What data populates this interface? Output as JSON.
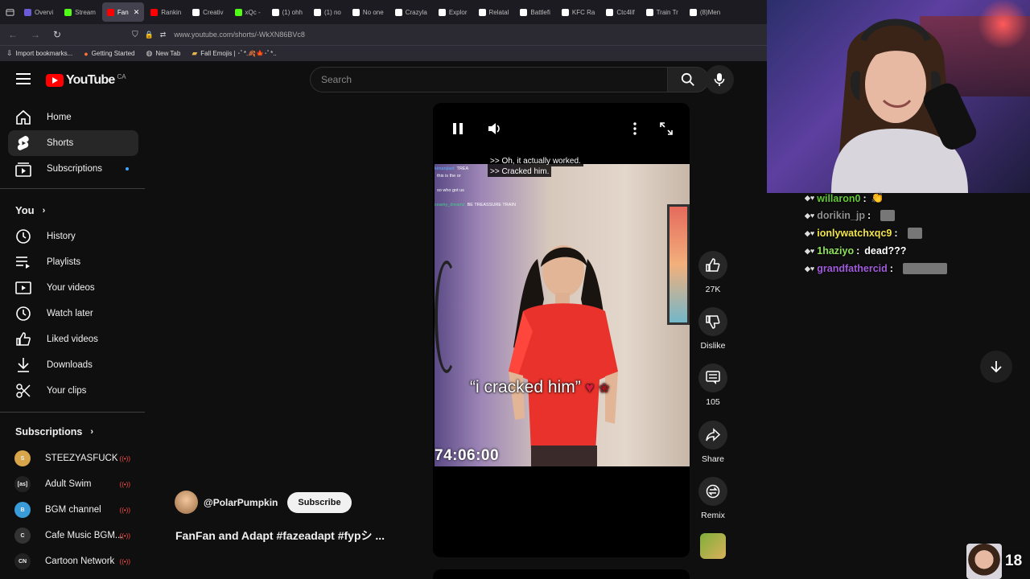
{
  "browser": {
    "tabs": [
      {
        "label": "Overvi",
        "color": "#6b5bd6"
      },
      {
        "label": "Stream",
        "color": "#53fc18"
      },
      {
        "label": "Fan",
        "color": "#ff0000",
        "active": true
      },
      {
        "label": "Rankin",
        "color": "#ff0000"
      },
      {
        "label": "Creativ",
        "color": "#ffffff"
      },
      {
        "label": "xQc -",
        "color": "#53fc18"
      },
      {
        "label": "(1) ohh",
        "color": "#ffffff"
      },
      {
        "label": "(1) no",
        "color": "#ffffff"
      },
      {
        "label": "No one",
        "color": "#ffffff"
      },
      {
        "label": "Crazyla",
        "color": "#ffffff"
      },
      {
        "label": "Explor",
        "color": "#ffffff"
      },
      {
        "label": "Relatal",
        "color": "#ffffff"
      },
      {
        "label": "Battlefi",
        "color": "#ffffff"
      },
      {
        "label": "KFC Ra",
        "color": "#ffffff"
      },
      {
        "label": "Ctc4lif",
        "color": "#ffffff"
      },
      {
        "label": "Train Tr",
        "color": "#ffffff"
      },
      {
        "label": "(8)Men",
        "color": "#ffffff"
      }
    ],
    "url": "www.youtube.com/shorts/-WkXN86BVc8",
    "bookmarks": [
      "Import bookmarks...",
      "Getting Started",
      "New Tab",
      "Fall Emojis | ･ﾟ*.🍂🍁･ﾟ*.."
    ]
  },
  "header": {
    "logo_text": "YouTube",
    "country": "CA",
    "search_placeholder": "Search"
  },
  "sidebar": {
    "main": [
      {
        "label": "Home",
        "icon": "home-icon"
      },
      {
        "label": "Shorts",
        "icon": "shorts-icon",
        "active": true
      },
      {
        "label": "Subscriptions",
        "icon": "subscriptions-icon"
      }
    ],
    "you_heading": "You",
    "you_items": [
      {
        "label": "History",
        "icon": "history-icon"
      },
      {
        "label": "Playlists",
        "icon": "playlists-icon"
      },
      {
        "label": "Your videos",
        "icon": "your-videos-icon"
      },
      {
        "label": "Watch later",
        "icon": "watch-later-icon"
      },
      {
        "label": "Liked videos",
        "icon": "liked-videos-icon"
      },
      {
        "label": "Downloads",
        "icon": "downloads-icon"
      },
      {
        "label": "Your clips",
        "icon": "clips-icon"
      }
    ],
    "subs_heading": "Subscriptions",
    "subs": [
      {
        "label": "STEEZYASFUCK",
        "avatar_color": "#d9a54a",
        "mark": "S"
      },
      {
        "label": "Adult Swim",
        "avatar_color": "#222222",
        "mark": "[as]"
      },
      {
        "label": "BGM channel",
        "avatar_color": "#3a9bd9",
        "mark": "B"
      },
      {
        "label": "Cafe Music BGM...",
        "avatar_color": "#333333",
        "mark": "C"
      },
      {
        "label": "Cartoon Network",
        "avatar_color": "#222222",
        "mark": "CN"
      }
    ]
  },
  "video": {
    "captions": [
      ">> Oh, it actually worked.",
      ">> Cracked him."
    ],
    "overlay_text": "“i cracked him”",
    "timer": "74:06:00",
    "mini_chat": [
      {
        "name": "kimanjiast",
        "text": "TREA"
      },
      {
        "name": "",
        "text": "this is the or"
      },
      {
        "name": "",
        "text": ""
      },
      {
        "name": "",
        "text": "so who got us"
      },
      {
        "name": "",
        "text": ""
      },
      {
        "name": "ceamy_dreamz",
        "text": "BE TREASSURE TRAIN"
      }
    ]
  },
  "channel": {
    "handle": "@PolarPumpkin",
    "subscribe_label": "Subscribe",
    "title": "FanFan and Adapt #fazeadapt #fypシ ..."
  },
  "actions": [
    {
      "label": "27K",
      "icon": "like-icon"
    },
    {
      "label": "Dislike",
      "icon": "dislike-icon"
    },
    {
      "label": "105",
      "icon": "comment-icon"
    },
    {
      "label": "Share",
      "icon": "share-icon"
    },
    {
      "label": "Remix",
      "icon": "remix-icon"
    }
  ],
  "stream_chat": [
    {
      "user": "willaron0",
      "msg": "👏",
      "color": "#63c936"
    },
    {
      "user": "dorikin_jp",
      "msg": "",
      "color": "#8f8f8f"
    },
    {
      "user": "ionlywatchxqc9",
      "msg": "",
      "color": "#f3e34a"
    },
    {
      "user": "1haziyo",
      "msg": "dead???",
      "color": "#8fe05c"
    },
    {
      "user": "grandfathercid",
      "msg": "",
      "color": "#a15bdc"
    }
  ],
  "viewer_count": "18"
}
